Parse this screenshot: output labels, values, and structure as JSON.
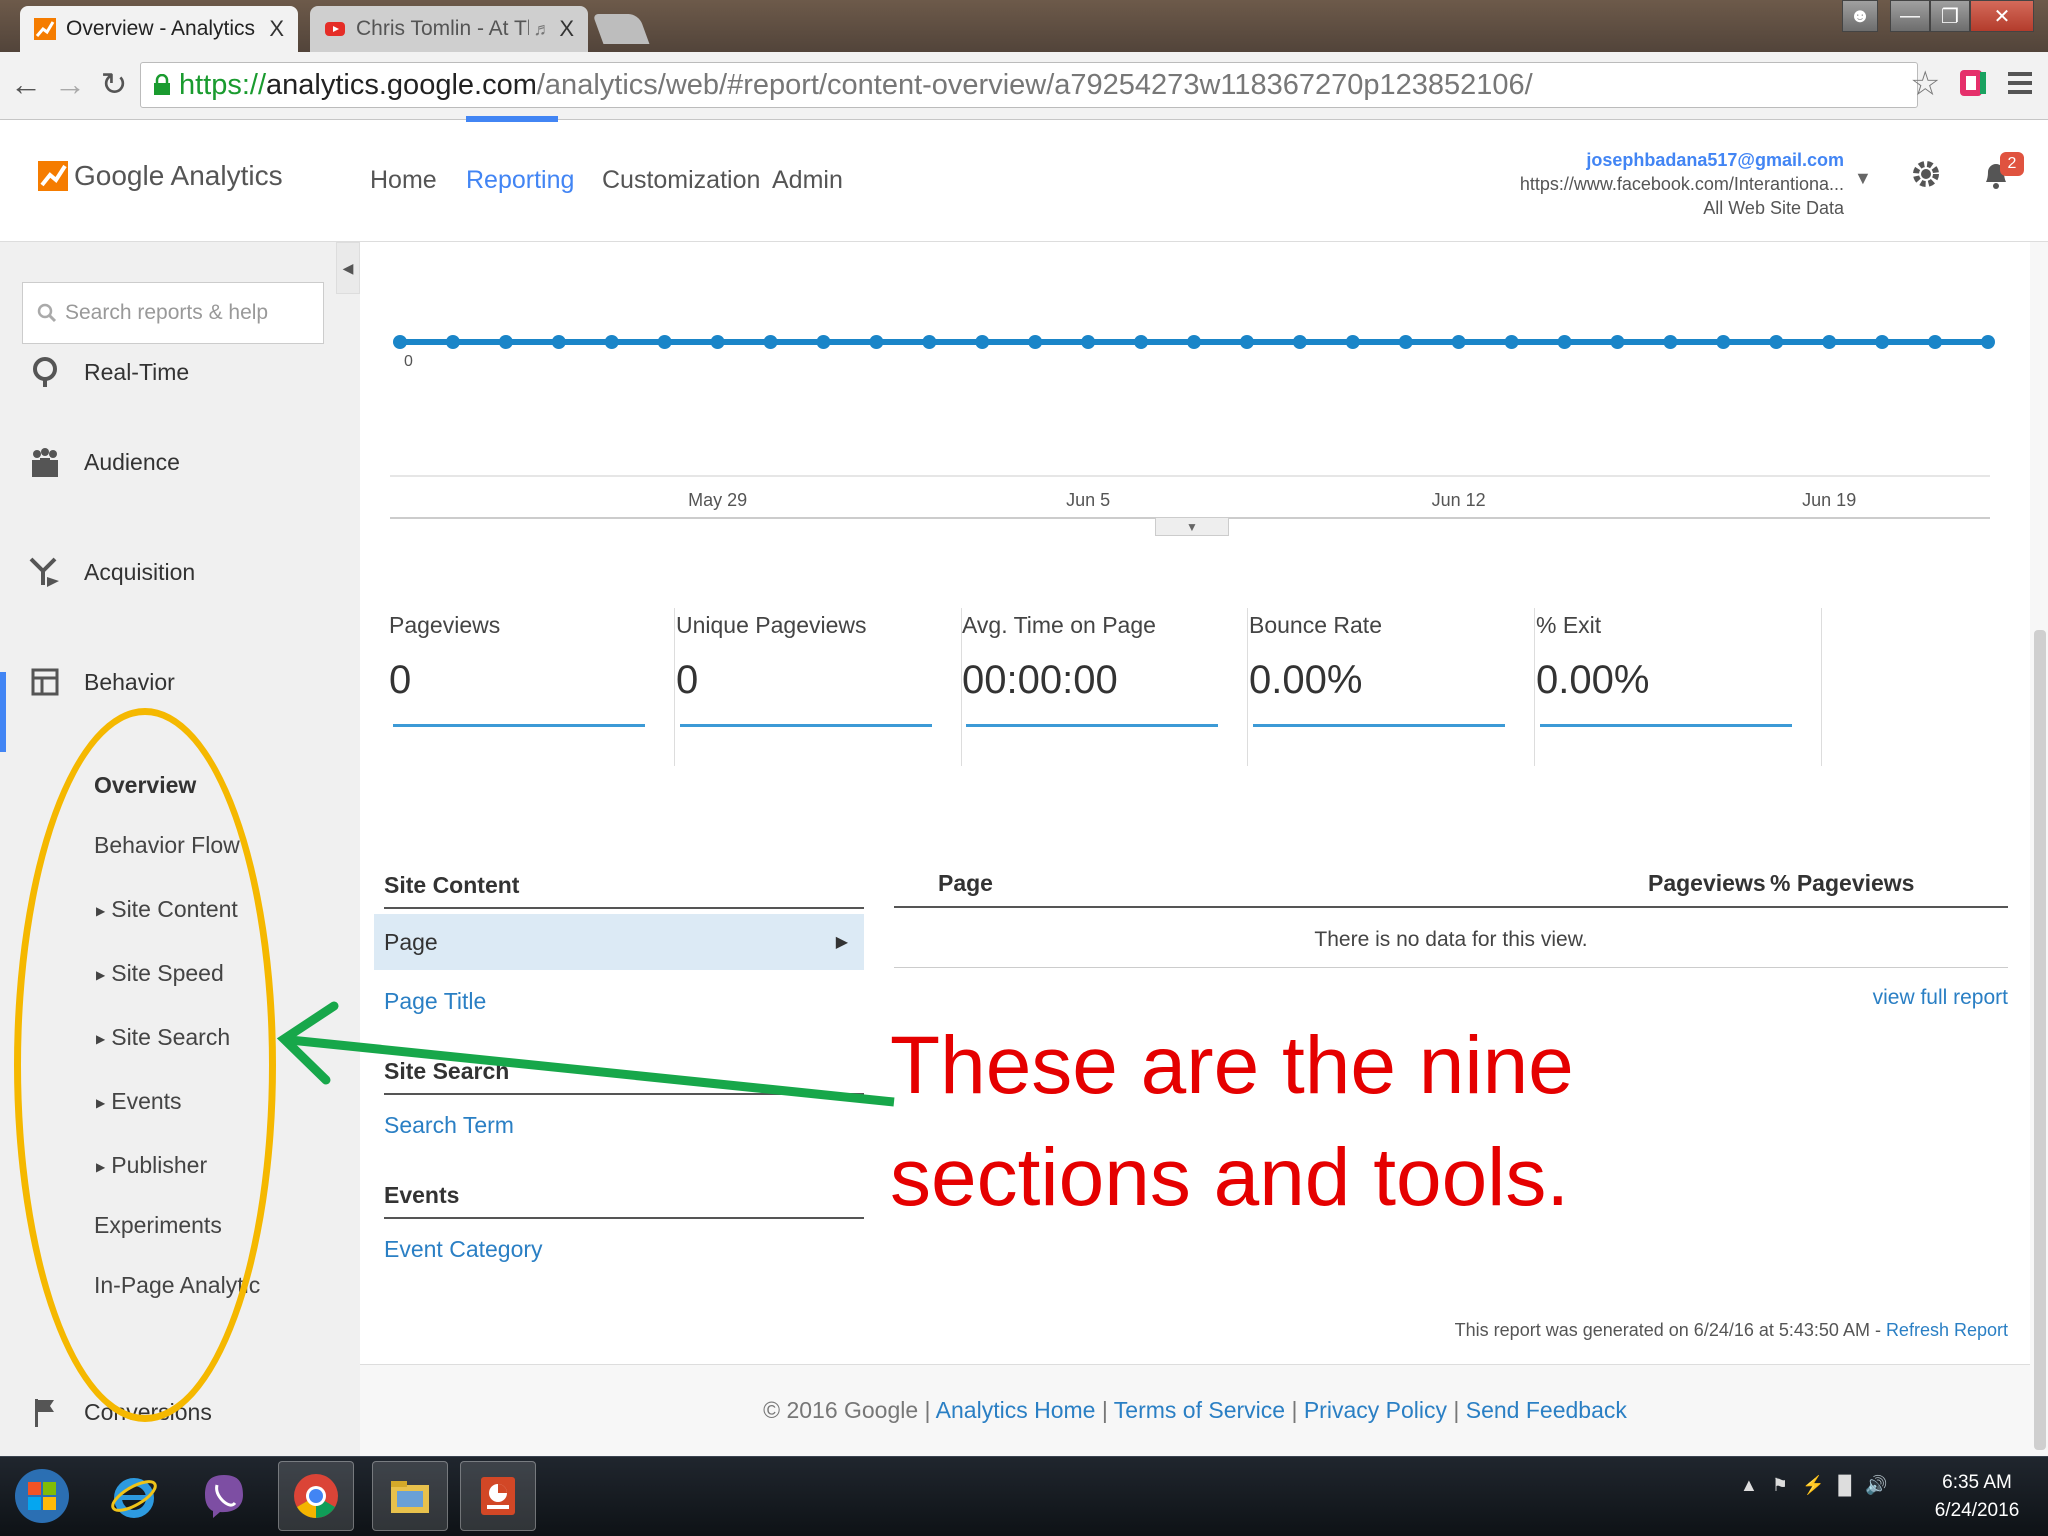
{
  "browser": {
    "tabs": [
      {
        "title": "Overview - Analytics",
        "close": "X"
      },
      {
        "title": "Chris Tomlin - At The C",
        "close": "X"
      }
    ],
    "url": {
      "scheme": "https://",
      "host": "analytics.google.com",
      "path": "/analytics/web/#report/content-overview/a79254273w118367270p123852106/"
    }
  },
  "ga_header": {
    "logo_text": "Google Analytics",
    "nav": [
      "Home",
      "Reporting",
      "Customization",
      "Admin"
    ],
    "active_nav": "Reporting",
    "account_email": "josephbadana517@gmail.com",
    "account_property": "https://www.facebook.com/Interantiona...",
    "account_view": "All Web Site Data",
    "notification_count": "2"
  },
  "sidebar": {
    "search_placeholder": "Search reports & help",
    "sections": [
      "Real-Time",
      "Audience",
      "Acquisition",
      "Behavior",
      "Conversions"
    ],
    "behavior_items": [
      {
        "label": "Overview",
        "expandable": false
      },
      {
        "label": "Behavior Flow",
        "expandable": false
      },
      {
        "label": "Site Content",
        "expandable": true
      },
      {
        "label": "Site Speed",
        "expandable": true
      },
      {
        "label": "Site Search",
        "expandable": true
      },
      {
        "label": "Events",
        "expandable": true
      },
      {
        "label": "Publisher",
        "expandable": true
      },
      {
        "label": "Experiments",
        "expandable": false
      },
      {
        "label": "In-Page Analytic",
        "expandable": false
      }
    ]
  },
  "chart_data": {
    "type": "line",
    "points": 31,
    "values": [
      0,
      0,
      0,
      0,
      0,
      0,
      0,
      0,
      0,
      0,
      0,
      0,
      0,
      0,
      0,
      0,
      0,
      0,
      0,
      0,
      0,
      0,
      0,
      0,
      0,
      0,
      0,
      0,
      0,
      0,
      0
    ],
    "y_label_zero": "0",
    "x_ticks": [
      "May 29",
      "Jun 5",
      "Jun 12",
      "Jun 19"
    ],
    "x_tick_index": [
      6,
      13,
      20,
      27
    ],
    "color": "#1a85c8"
  },
  "metrics": [
    {
      "label": "Pageviews",
      "value": "0"
    },
    {
      "label": "Unique Pageviews",
      "value": "0"
    },
    {
      "label": "Avg. Time on Page",
      "value": "00:00:00"
    },
    {
      "label": "Bounce Rate",
      "value": "0.00%"
    },
    {
      "label": "% Exit",
      "value": "0.00%"
    }
  ],
  "site_content": {
    "heading": "Site Content",
    "selected": "Page",
    "link": "Page Title"
  },
  "site_search": {
    "heading": "Site Search",
    "link": "Search Term"
  },
  "events": {
    "heading": "Events",
    "link": "Event Category"
  },
  "table": {
    "headers": [
      "Page",
      "Pageviews",
      "% Pageviews"
    ],
    "empty_message": "There is no data for this view.",
    "view_full": "view full report"
  },
  "callout": {
    "line1": "These are the nine",
    "line2": "sections and tools."
  },
  "report_info": {
    "generated": "This report was generated on 6/24/16 at 5:43:50 AM - ",
    "refresh": "Refresh Report"
  },
  "footer": {
    "copyright": "© 2016 Google",
    "links": [
      "Analytics Home",
      "Terms of Service",
      "Privacy Policy",
      "Send Feedback"
    ],
    "separator": " | "
  },
  "taskbar": {
    "time": "6:35 AM",
    "date": "6/24/2016"
  }
}
